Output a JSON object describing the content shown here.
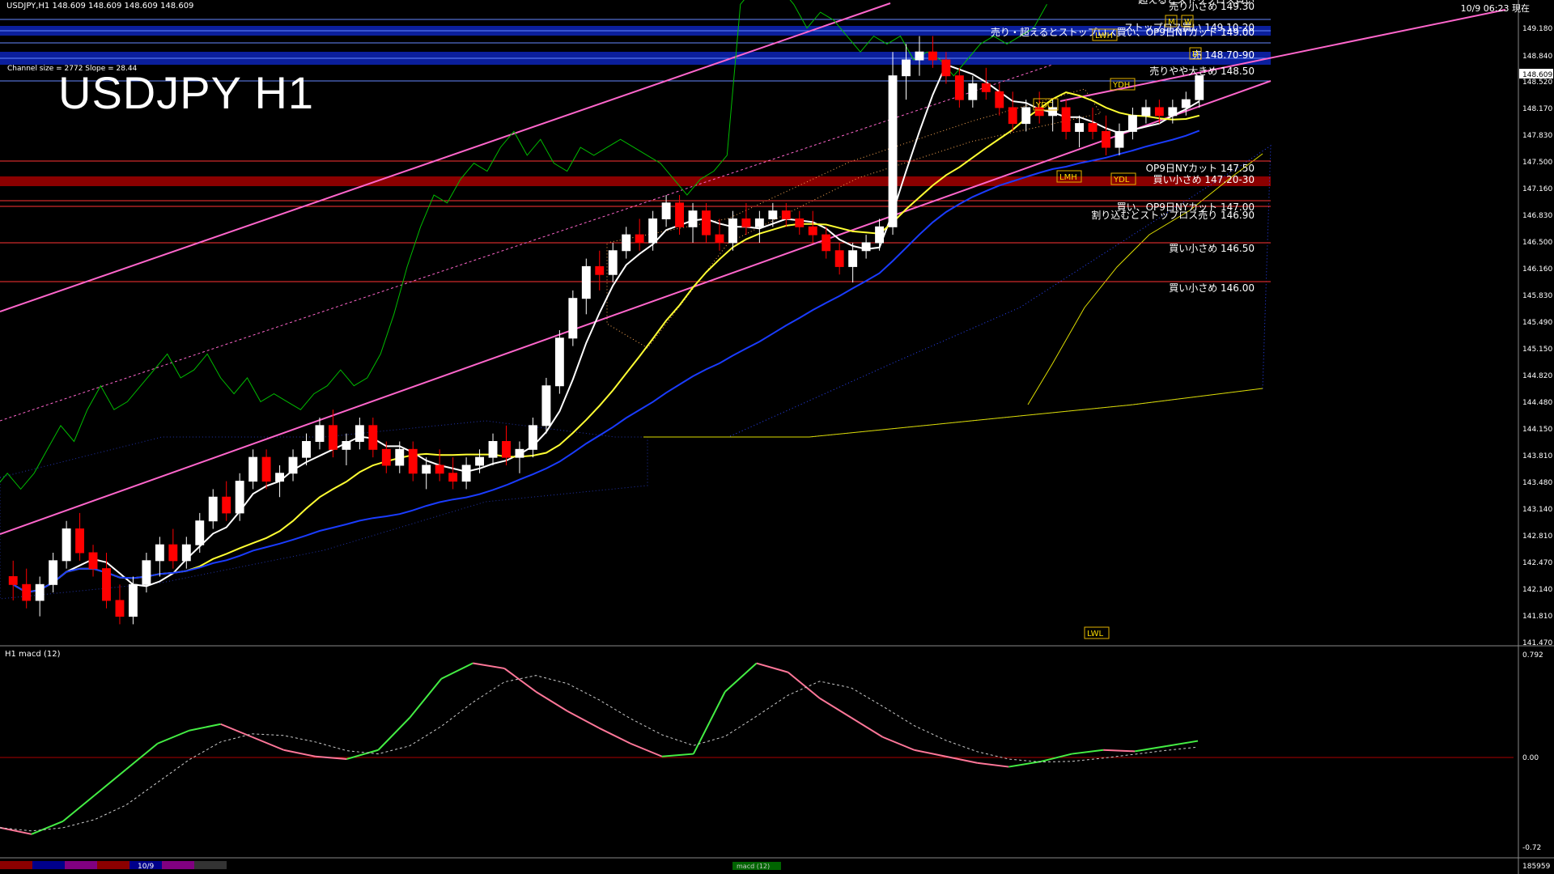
{
  "header": {
    "symbol_line": "USDJPY,H1  148.609 148.609 148.609 148.609",
    "clock": "10/9 06:23 現在",
    "title": "USDJPY H1",
    "channel_info": "Channel size = 2772 Slope = 28.44",
    "macd_label": "H1  macd (12)",
    "date_tag": "10/9",
    "macd_tag": "macd (12)",
    "bottom_right": "185959"
  },
  "colors": {
    "background": "#000000",
    "bull": "#ffffff",
    "bear": "#ff0000",
    "sma_white": "#ffffff",
    "sma_yellow": "#ffff33",
    "sma_blue": "#1a3cff",
    "channel": "#ff66cc",
    "chikou": "#00bb00",
    "resistance_band": "#0b1f9c",
    "support_band": "#8b0000",
    "kumo_pos": "#3344ff",
    "kumo_neg": "#ffaa55",
    "macd_up": "#44ee44",
    "macd_down": "#ff7799"
  },
  "price_axis": {
    "labels": [
      "149.180",
      "148.840",
      "148.609",
      "148.520",
      "148.170",
      "147.830",
      "147.500",
      "147.160",
      "146.830",
      "146.500",
      "146.160",
      "145.830",
      "145.490",
      "145.150",
      "144.820",
      "144.480",
      "144.150",
      "143.810",
      "143.480",
      "143.140",
      "142.810",
      "142.470",
      "142.140",
      "141.810",
      "141.470"
    ],
    "current_price": "148.609"
  },
  "macd_axis": {
    "labels": [
      "0.792",
      "0.00",
      "-0.72"
    ]
  },
  "level_notes": [
    {
      "text": "超えるとストップロス買い",
      "kind": "white"
    },
    {
      "text": "売り小さめ 149.30",
      "kind": "white"
    },
    {
      "text": "ストップロス買い 149.10-20",
      "kind": "white"
    },
    {
      "text": "売り・超えるとストップロス買い、OP9日NYカット 149.00",
      "kind": "white"
    },
    {
      "text": "売 148.70-90",
      "kind": "white"
    },
    {
      "text": "売りやや大きめ 148.50",
      "kind": "white"
    },
    {
      "text": "OP9日NYカット 147.50",
      "kind": "white"
    },
    {
      "text": "買い小さめ 147.20-30",
      "kind": "white"
    },
    {
      "text": "買い、OP9日NYカット 147.00",
      "kind": "white"
    },
    {
      "text": "割り込むとストップロス売り 146.90",
      "kind": "white"
    },
    {
      "text": "買い小さめ 146.50",
      "kind": "white"
    },
    {
      "text": "買い小さめ 146.00",
      "kind": "white"
    }
  ],
  "tags": [
    "LWH",
    "YDH",
    "YDC",
    "YDL",
    "LMH",
    "LWL",
    "M",
    "W",
    "D"
  ],
  "chart_data": [
    {
      "type": "line",
      "name": "candlestick price",
      "y_range": [
        141.47,
        149.35
      ],
      "candles": [
        [
          142.3,
          142.5,
          142.0,
          142.2
        ],
        [
          142.2,
          142.4,
          141.9,
          142.0
        ],
        [
          142.0,
          142.3,
          141.8,
          142.2
        ],
        [
          142.2,
          142.6,
          142.1,
          142.5
        ],
        [
          142.5,
          143.0,
          142.4,
          142.9
        ],
        [
          142.9,
          143.1,
          142.5,
          142.6
        ],
        [
          142.6,
          142.7,
          142.3,
          142.4
        ],
        [
          142.4,
          142.6,
          141.9,
          142.0
        ],
        [
          142.0,
          142.2,
          141.7,
          141.8
        ],
        [
          141.8,
          142.3,
          141.7,
          142.2
        ],
        [
          142.2,
          142.6,
          142.1,
          142.5
        ],
        [
          142.5,
          142.8,
          142.3,
          142.7
        ],
        [
          142.7,
          142.9,
          142.4,
          142.5
        ],
        [
          142.5,
          142.8,
          142.4,
          142.7
        ],
        [
          142.7,
          143.1,
          142.6,
          143.0
        ],
        [
          143.0,
          143.4,
          142.9,
          143.3
        ],
        [
          143.3,
          143.5,
          143.0,
          143.1
        ],
        [
          143.1,
          143.6,
          143.0,
          143.5
        ],
        [
          143.5,
          143.9,
          143.4,
          143.8
        ],
        [
          143.8,
          143.9,
          143.4,
          143.5
        ],
        [
          143.5,
          143.7,
          143.3,
          143.6
        ],
        [
          143.6,
          143.9,
          143.5,
          143.8
        ],
        [
          143.8,
          144.1,
          143.7,
          144.0
        ],
        [
          144.0,
          144.3,
          143.9,
          144.2
        ],
        [
          144.2,
          144.4,
          143.8,
          143.9
        ],
        [
          143.9,
          144.1,
          143.7,
          144.0
        ],
        [
          144.0,
          144.3,
          143.9,
          144.2
        ],
        [
          144.2,
          144.3,
          143.8,
          143.9
        ],
        [
          143.9,
          144.0,
          143.6,
          143.7
        ],
        [
          143.7,
          144.0,
          143.6,
          143.9
        ],
        [
          143.9,
          144.0,
          143.5,
          143.6
        ],
        [
          143.6,
          143.8,
          143.4,
          143.7
        ],
        [
          143.7,
          143.9,
          143.5,
          143.6
        ],
        [
          143.6,
          143.8,
          143.4,
          143.5
        ],
        [
          143.5,
          143.8,
          143.4,
          143.7
        ],
        [
          143.7,
          143.9,
          143.6,
          143.8
        ],
        [
          143.8,
          144.1,
          143.7,
          144.0
        ],
        [
          144.0,
          144.2,
          143.7,
          143.8
        ],
        [
          143.8,
          144.0,
          143.6,
          143.9
        ],
        [
          143.9,
          144.3,
          143.8,
          144.2
        ],
        [
          144.2,
          144.8,
          144.1,
          144.7
        ],
        [
          144.7,
          145.4,
          144.6,
          145.3
        ],
        [
          145.3,
          145.9,
          145.2,
          145.8
        ],
        [
          145.8,
          146.3,
          145.6,
          146.2
        ],
        [
          146.2,
          146.4,
          145.9,
          146.1
        ],
        [
          146.1,
          146.5,
          146.0,
          146.4
        ],
        [
          146.4,
          146.7,
          146.3,
          146.6
        ],
        [
          146.6,
          146.8,
          146.4,
          146.5
        ],
        [
          146.5,
          146.9,
          146.4,
          146.8
        ],
        [
          146.8,
          147.1,
          146.7,
          147.0
        ],
        [
          147.0,
          147.1,
          146.6,
          146.7
        ],
        [
          146.7,
          147.0,
          146.5,
          146.9
        ],
        [
          146.9,
          147.0,
          146.5,
          146.6
        ],
        [
          146.6,
          146.8,
          146.4,
          146.5
        ],
        [
          146.5,
          146.9,
          146.4,
          146.8
        ],
        [
          146.8,
          147.0,
          146.6,
          146.7
        ],
        [
          146.7,
          146.9,
          146.5,
          146.8
        ],
        [
          146.8,
          147.0,
          146.7,
          146.9
        ],
        [
          146.9,
          147.0,
          146.7,
          146.8
        ],
        [
          146.8,
          146.9,
          146.6,
          146.7
        ],
        [
          146.7,
          146.9,
          146.5,
          146.6
        ],
        [
          146.6,
          146.7,
          146.3,
          146.4
        ],
        [
          146.4,
          146.5,
          146.1,
          146.2
        ],
        [
          146.2,
          146.5,
          146.0,
          146.4
        ],
        [
          146.4,
          146.6,
          146.3,
          146.5
        ],
        [
          146.5,
          146.8,
          146.4,
          146.7
        ],
        [
          146.7,
          148.9,
          146.6,
          148.6
        ],
        [
          148.6,
          149.0,
          148.3,
          148.8
        ],
        [
          148.8,
          149.1,
          148.6,
          148.9
        ],
        [
          148.9,
          149.1,
          148.7,
          148.8
        ],
        [
          148.8,
          148.9,
          148.5,
          148.6
        ],
        [
          148.6,
          148.7,
          148.2,
          148.3
        ],
        [
          148.3,
          148.6,
          148.2,
          148.5
        ],
        [
          148.5,
          148.7,
          148.3,
          148.4
        ],
        [
          148.4,
          148.5,
          148.1,
          148.2
        ],
        [
          148.2,
          148.4,
          147.9,
          148.0
        ],
        [
          148.0,
          148.3,
          147.9,
          148.2
        ],
        [
          148.2,
          148.4,
          148.0,
          148.1
        ],
        [
          148.1,
          148.3,
          147.9,
          148.2
        ],
        [
          148.2,
          148.3,
          147.8,
          147.9
        ],
        [
          147.9,
          148.1,
          147.7,
          148.0
        ],
        [
          148.0,
          148.2,
          147.8,
          147.9
        ],
        [
          147.9,
          148.1,
          147.6,
          147.7
        ],
        [
          147.7,
          148.0,
          147.6,
          147.9
        ],
        [
          147.9,
          148.2,
          147.8,
          148.1
        ],
        [
          148.1,
          148.3,
          148.0,
          148.2
        ],
        [
          148.2,
          148.3,
          148.0,
          148.1
        ],
        [
          148.1,
          148.3,
          148.0,
          148.2
        ],
        [
          148.2,
          148.4,
          148.1,
          148.3
        ],
        [
          148.3,
          148.6,
          148.2,
          148.6
        ]
      ]
    },
    {
      "type": "line",
      "name": "macd",
      "values": [
        -0.55,
        -0.6,
        -0.5,
        -0.3,
        -0.1,
        0.1,
        0.2,
        0.25,
        0.15,
        0.05,
        0.0,
        -0.02,
        0.05,
        0.3,
        0.6,
        0.72,
        0.68,
        0.5,
        0.35,
        0.22,
        0.1,
        0.0,
        0.02,
        0.5,
        0.72,
        0.65,
        0.45,
        0.3,
        0.15,
        0.05,
        0.0,
        -0.05,
        -0.08,
        -0.04,
        0.02,
        0.05,
        0.04,
        0.08,
        0.12
      ]
    }
  ]
}
